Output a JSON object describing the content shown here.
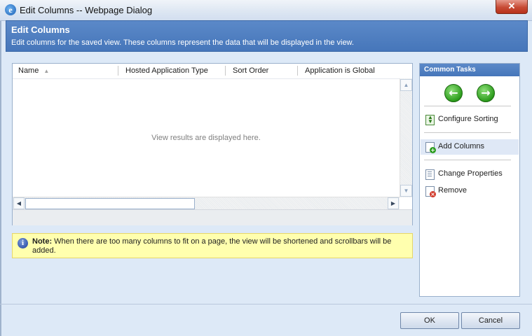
{
  "window": {
    "title": "Edit Columns -- Webpage Dialog",
    "close_glyph": "✕"
  },
  "header": {
    "title": "Edit Columns",
    "subtitle": "Edit columns for the saved view. These columns represent the data that will be displayed in the view."
  },
  "grid": {
    "columns": [
      "Name",
      "Hosted Application Type",
      "Sort Order",
      "Application is Global"
    ],
    "sort_indicator": "▲",
    "empty_message": "View results are displayed here."
  },
  "note": {
    "label": "Note:",
    "text": "When there are too many columns to fit on a page, the view will be shortened and scrollbars will be added."
  },
  "tasks": {
    "title": "Common Tasks",
    "items": [
      {
        "label": "Configure Sorting",
        "icon": "configure-sorting-icon"
      },
      {
        "label": "Add Columns",
        "icon": "add-columns-icon"
      },
      {
        "label": "Change Properties",
        "icon": "change-properties-icon"
      },
      {
        "label": "Remove",
        "icon": "remove-icon"
      }
    ]
  },
  "buttons": {
    "ok": "OK",
    "cancel": "Cancel"
  },
  "colors": {
    "header_blue": "#4b7cc0",
    "note_bg": "#ffffae",
    "arrow_green": "#2c9c1c"
  }
}
